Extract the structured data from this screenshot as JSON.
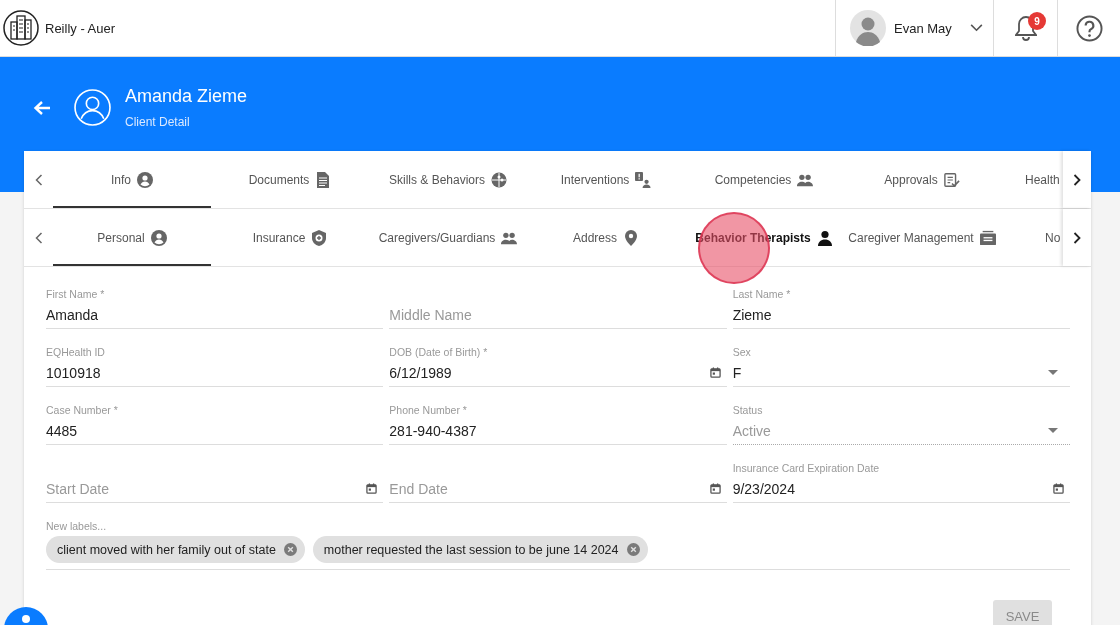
{
  "header": {
    "org_name": "Reilly - Auer",
    "user_name": "Evan May",
    "notification_count": "9"
  },
  "banner": {
    "title": "Amanda Zieme",
    "subtitle": "Client Detail"
  },
  "main_tabs": [
    {
      "label": "Info",
      "selected": true
    },
    {
      "label": "Documents",
      "selected": false
    },
    {
      "label": "Skills & Behaviors",
      "selected": false
    },
    {
      "label": "Interventions",
      "selected": false
    },
    {
      "label": "Competencies",
      "selected": false
    },
    {
      "label": "Approvals",
      "selected": false
    },
    {
      "label": "Health",
      "selected": false
    }
  ],
  "sub_tabs": [
    {
      "label": "Personal",
      "selected": true,
      "hovered": false
    },
    {
      "label": "Insurance",
      "selected": false,
      "hovered": false
    },
    {
      "label": "Caregivers/Guardians",
      "selected": false,
      "hovered": false
    },
    {
      "label": "Address",
      "selected": false,
      "hovered": false
    },
    {
      "label": "Behavior Therapists",
      "selected": false,
      "hovered": true
    },
    {
      "label": "Caregiver Management",
      "selected": false,
      "hovered": false
    },
    {
      "label": "No",
      "selected": false,
      "hovered": false
    }
  ],
  "fields": [
    {
      "kind": "text",
      "label": "First Name *",
      "value": "Amanda",
      "disabled": false
    },
    {
      "kind": "text",
      "placeholder": "Middle Name",
      "disabled": false
    },
    {
      "kind": "text",
      "label": "Last Name *",
      "value": "Zieme",
      "disabled": false
    },
    {
      "kind": "text",
      "label": "EQHealth ID",
      "value": "1010918",
      "disabled": false
    },
    {
      "kind": "date",
      "label": "DOB (Date of Birth) *",
      "value": "6/12/1989",
      "disabled": false
    },
    {
      "kind": "select",
      "label": "Sex",
      "value": "F",
      "disabled": false
    },
    {
      "kind": "text",
      "label": "Case Number *",
      "value": "4485",
      "disabled": false
    },
    {
      "kind": "text",
      "label": "Phone Number *",
      "value": "281-940-4387",
      "disabled": false
    },
    {
      "kind": "select",
      "label": "Status",
      "value": "Active",
      "disabled": true
    },
    {
      "kind": "date",
      "placeholder": "Start Date",
      "disabled": false
    },
    {
      "kind": "date",
      "placeholder": "End Date",
      "disabled": false
    },
    {
      "kind": "date",
      "label": "Insurance Card Expiration Date",
      "value": "9/23/2024",
      "disabled": false
    }
  ],
  "labels_field": {
    "label": "New labels...",
    "chips": [
      "client moved with her family out of state",
      "mother requested the last session to be june 14 2024"
    ]
  },
  "save_button": {
    "label": "SAVE",
    "disabled": true
  },
  "click_indicator": {
    "visible": true
  }
}
